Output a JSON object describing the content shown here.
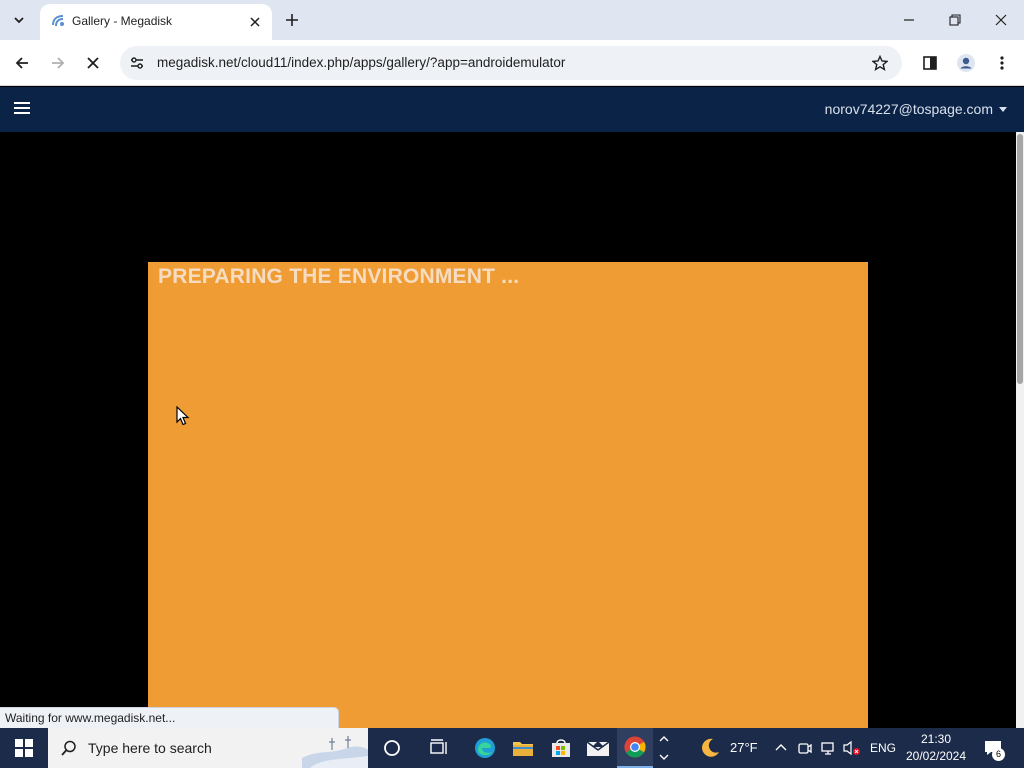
{
  "browser": {
    "tab": {
      "title": "Gallery - Megadisk"
    },
    "url": "megadisk.net/cloud11/index.php/apps/gallery/?app=androidemulator",
    "status_text": "Waiting for www.megadisk.net..."
  },
  "app": {
    "user_email": "norov74227@tospage.com",
    "emulator_message": "PREPARING THE ENVIRONMENT ...",
    "emulator_color": "#ef9c35",
    "header_color": "#0b2346"
  },
  "taskbar": {
    "search_placeholder": "Type here to search",
    "weather_temp": "27°F",
    "language": "ENG",
    "time": "21:30",
    "date": "20/02/2024",
    "notification_count": "6"
  }
}
